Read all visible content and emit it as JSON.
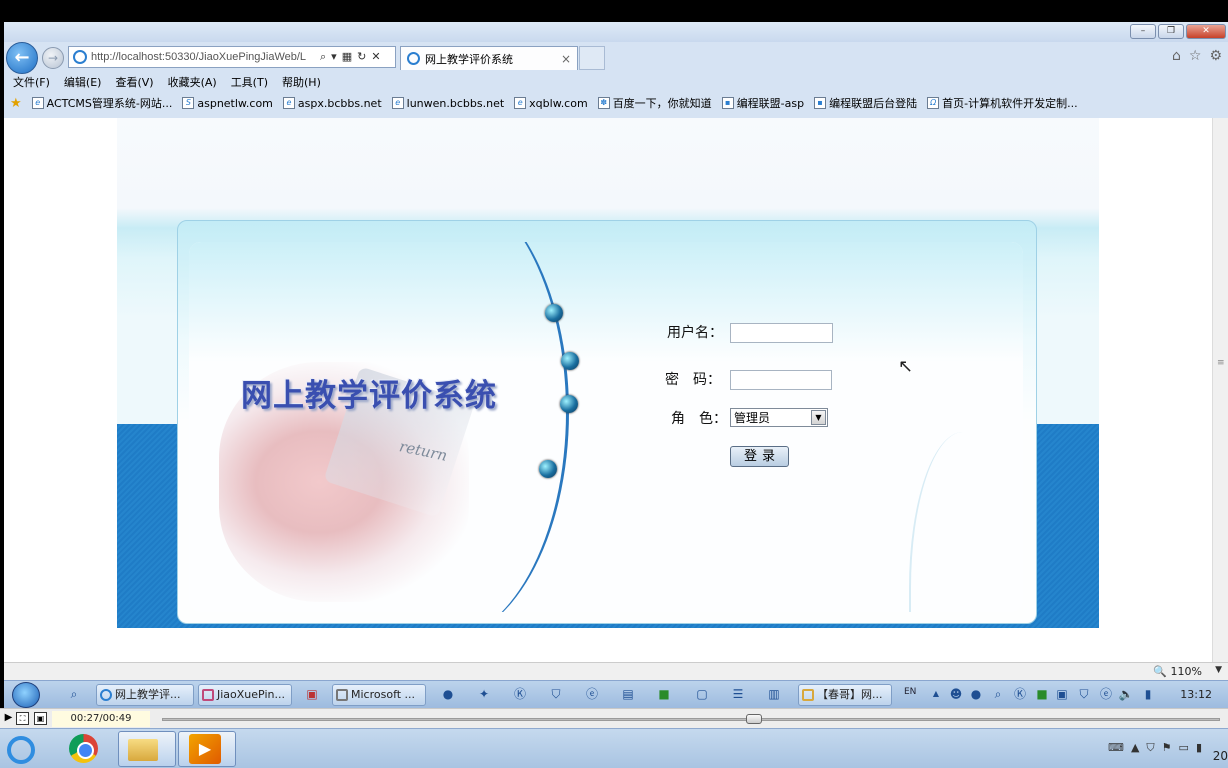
{
  "browser": {
    "url": "http://localhost:50330/JiaoXuePingJiaWeb/L",
    "tab_title": "网上教学评价系统",
    "menu": [
      "文件(F)",
      "编辑(E)",
      "查看(V)",
      "收藏夹(A)",
      "工具(T)",
      "帮助(H)"
    ],
    "favorites": [
      "ACTCMS管理系统-网站...",
      "aspnetlw.com",
      "aspx.bcbbs.net",
      "lunwen.bcbbs.net",
      "xqblw.com",
      "百度一下，你就知道",
      "编程联盟-asp",
      "编程联盟后台登陆",
      "首页-计算机软件开发定制..."
    ],
    "zoom": "110%"
  },
  "login": {
    "system_title": "网上教学评价系统",
    "username_label": "用户名：",
    "password_label": "密　码：",
    "role_label": "角　色：",
    "role_value": "管理员",
    "submit_label": "登录",
    "decor_key_text": "return"
  },
  "taskbar": {
    "buttons": [
      "网上教学评...",
      "JiaoXuePin...",
      "Microsoft ...",
      "【春哥】网..."
    ],
    "lang": "EN",
    "clock": "13:12"
  },
  "player": {
    "time": "00:27/00:49",
    "progress": 0.56
  },
  "host_taskbar": {
    "clock": "20"
  },
  "colors": {
    "accent_blue": "#2585cd",
    "title_blue": "#3a4fb0"
  }
}
